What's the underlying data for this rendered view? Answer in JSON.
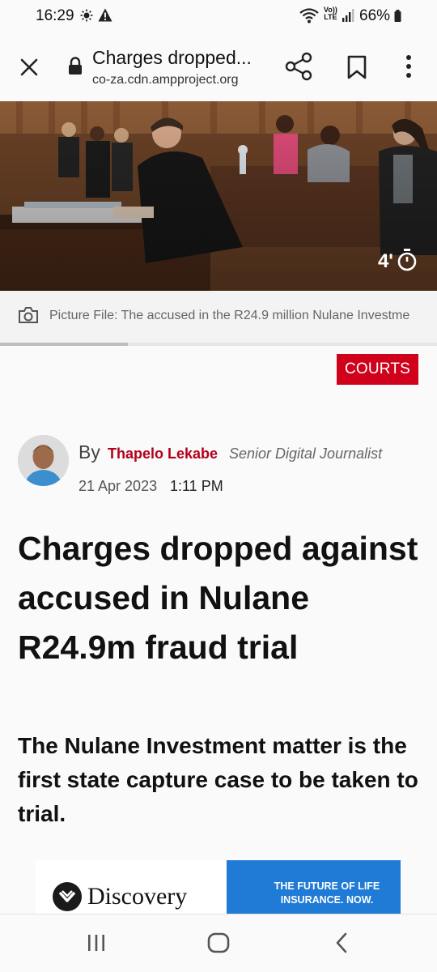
{
  "status_bar": {
    "time": "16:29",
    "lte_top": "Vo))",
    "lte_bottom": "LTE",
    "battery": "66%"
  },
  "browser": {
    "page_title": "Charges dropped...",
    "host": "co-za.cdn.ampproject.org"
  },
  "hero": {
    "gallery_count": "4'"
  },
  "caption": {
    "text": "Picture File: The accused in the R24.9 million Nulane Investme"
  },
  "article": {
    "category": "COURTS",
    "by_label": "By",
    "author": "Thapelo Lekabe",
    "author_role": "Senior Digital Journalist",
    "date": "21 Apr 2023",
    "time": "1:11 PM",
    "headline": "Charges dropped against accused in Nulane R24.9m fraud trial",
    "subheadline": "The Nulane Investment matter is the first state capture case to be taken to trial."
  },
  "ad": {
    "brand": "Discovery",
    "tagline_line1": "THE FUTURE OF LIFE",
    "tagline_line2": "INSURANCE. NOW."
  },
  "colors": {
    "accent_red": "#d0021b",
    "author_red": "#b3001b",
    "ad_blue": "#1f7bd6"
  }
}
